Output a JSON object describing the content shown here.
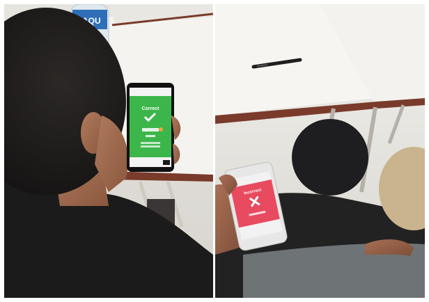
{
  "left_photo": {
    "bottle_label_text": "AQU",
    "phone_screen": {
      "status": "Correct",
      "status_color": "#3cb64a",
      "icon": "checkmark-icon",
      "streak_badge_color": "#f2a23a",
      "next_button_color": "#1a1a1a"
    }
  },
  "right_photo": {
    "phone_screen": {
      "status": "Incorrect",
      "status_color": "#e84a5f",
      "icon": "cross-icon"
    }
  }
}
